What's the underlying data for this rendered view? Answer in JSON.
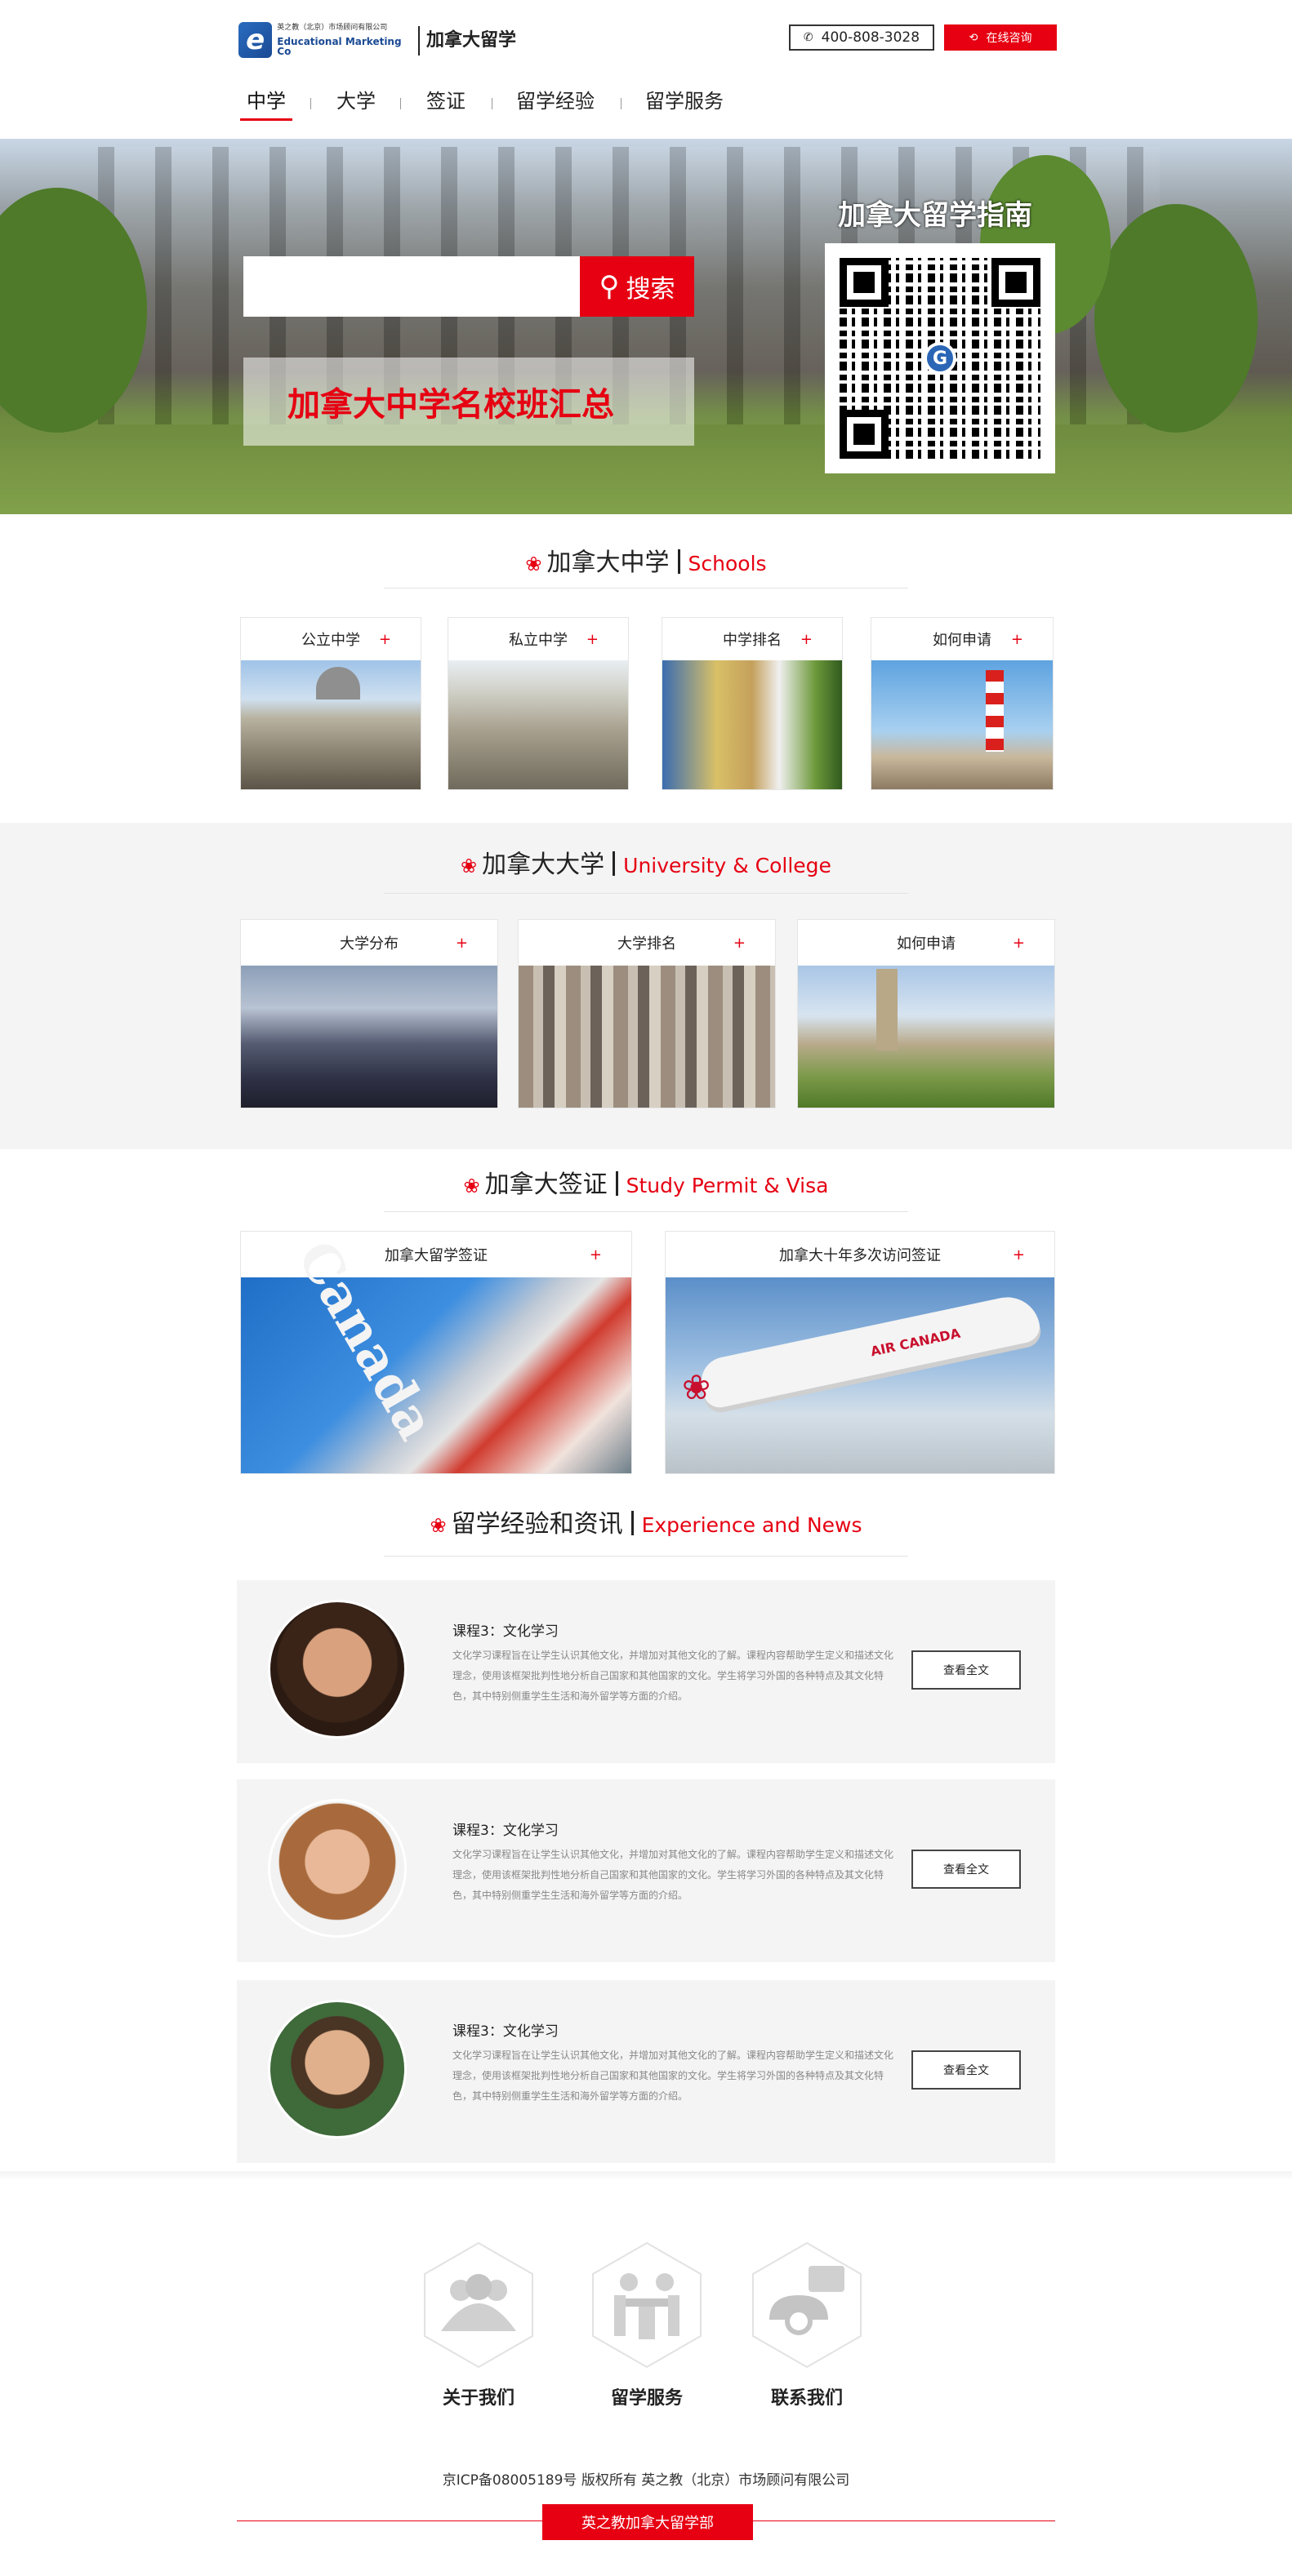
{
  "header": {
    "logo_cn": "英之教（北京）市场顾问有限公司",
    "logo_en": "Educational Marketing Co",
    "brand_title": "加拿大留学",
    "phone": "400-808-3028",
    "consult_label": "在线咨询"
  },
  "nav": {
    "items": [
      "中学",
      "大学",
      "签证",
      "留学经验",
      "留学服务"
    ],
    "active": "中学"
  },
  "banner": {
    "search_button": "搜索",
    "search_placeholder": "",
    "promo_text": "加拿大中学名校班汇总",
    "guide_title": "加拿大留学指南"
  },
  "schools": {
    "title": "加拿大中学",
    "title_en": "Schools",
    "cards": [
      {
        "label": "公立中学",
        "plus": "+"
      },
      {
        "label": "私立中学",
        "plus": "+"
      },
      {
        "label": "中学排名",
        "plus": "+"
      },
      {
        "label": "如何申请",
        "plus": "+"
      }
    ]
  },
  "university": {
    "title": "加拿大大学",
    "title_en": "University & College",
    "cards": [
      {
        "label": "大学分布",
        "plus": "+"
      },
      {
        "label": "大学排名",
        "plus": "+"
      },
      {
        "label": "如何申请",
        "plus": "+"
      }
    ]
  },
  "visa": {
    "title": "加拿大签证",
    "title_en": "Study Permit & Visa",
    "cards": [
      {
        "label": "加拿大留学签证",
        "plus": "+"
      },
      {
        "label": "加拿大十年多次访问签证",
        "plus": "+"
      }
    ],
    "plane_text": "AIR CANADA"
  },
  "news": {
    "title": "留学经验和资讯",
    "title_en": "Experience and News",
    "items": [
      {
        "title": "课程3：文化学习",
        "text": "文化学习课程旨在让学生认识其他文化，并增加对其他文化的了解。课程内容帮助学生定义和描述文化理念，使用该框架批判性地分析自己国家和其他国家的文化。学生将学习外国的各种特点及其文化特色，其中特别侧重学生生活和海外留学等方面的介绍。",
        "button": "查看全文"
      },
      {
        "title": "课程3：文化学习",
        "text": "文化学习课程旨在让学生认识其他文化，并增加对其他文化的了解。课程内容帮助学生定义和描述文化理念，使用该框架批判性地分析自己国家和其他国家的文化。学生将学习外国的各种特点及其文化特色，其中特别侧重学生生活和海外留学等方面的介绍。",
        "button": "查看全文"
      },
      {
        "title": "课程3：文化学习",
        "text": "文化学习课程旨在让学生认识其他文化，并增加对其他文化的了解。课程内容帮助学生定义和描述文化理念，使用该框架批判性地分析自己国家和其他国家的文化。学生将学习外国的各种特点及其文化特色，其中特别侧重学生生活和海外留学等方面的介绍。",
        "button": "查看全文"
      }
    ]
  },
  "footer": {
    "links": [
      {
        "label": "关于我们",
        "icon": "people-icon"
      },
      {
        "label": "留学服务",
        "icon": "meeting-icon"
      },
      {
        "label": "联系我们",
        "icon": "telephone-icon"
      }
    ],
    "icp": "京ICP备08005189号 版权所有 英之教（北京）市场顾问有限公司",
    "tag": "英之教加拿大留学部"
  },
  "colors": {
    "accent": "#e60012",
    "band": "#f4f4f4",
    "logo_blue": "#1a4a94"
  }
}
